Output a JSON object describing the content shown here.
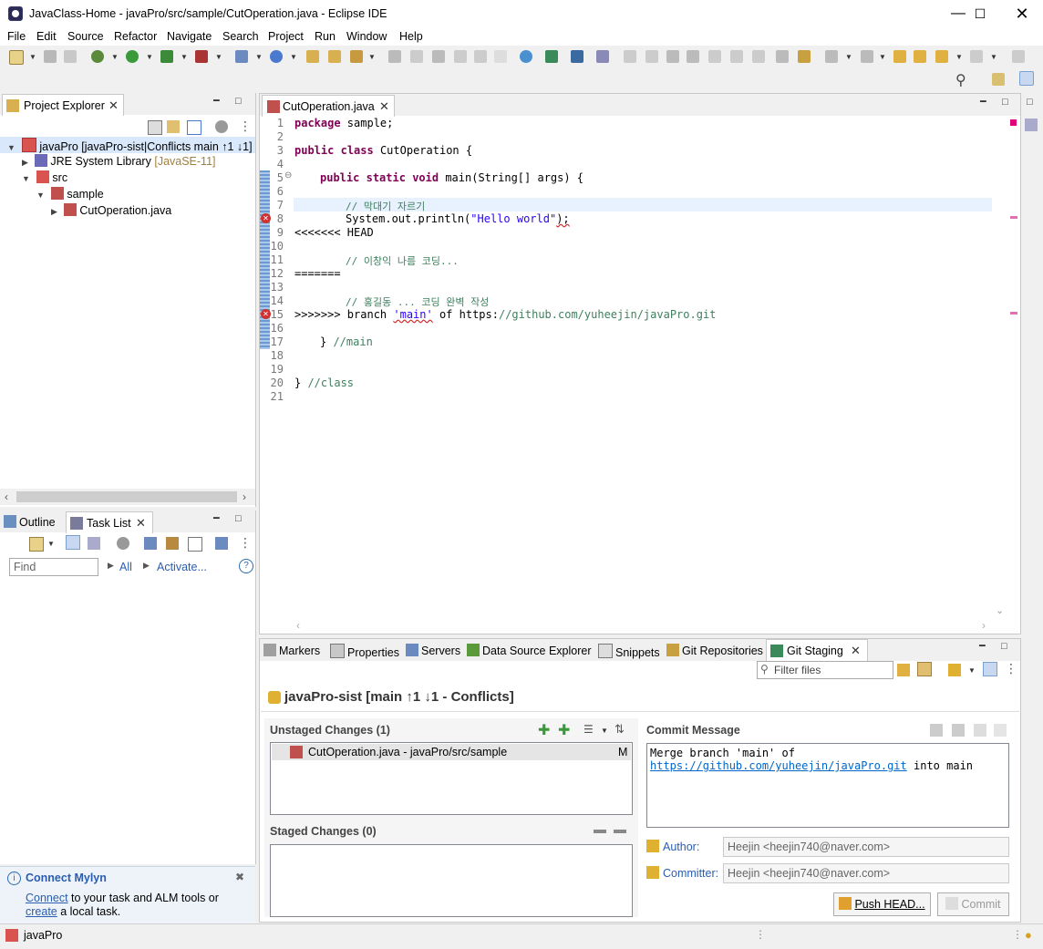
{
  "window": {
    "title": "JavaClass-Home - javaPro/src/sample/CutOperation.java - Eclipse IDE"
  },
  "menu": [
    "File",
    "Edit",
    "Source",
    "Refactor",
    "Navigate",
    "Search",
    "Project",
    "Run",
    "Window",
    "Help"
  ],
  "project_explorer": {
    "tab": "Project Explorer",
    "project": "javaPro [javaPro-sist|Conflicts main ↑1 ↓1]",
    "jre": "JRE System Library",
    "jre_version": "[JavaSE-11]",
    "src": "src",
    "package": "sample",
    "file": "CutOperation.java"
  },
  "outline": {
    "tab_outline": "Outline",
    "tab_tasklist": "Task List",
    "find_placeholder": "Find",
    "all": "All",
    "activate": "Activate..."
  },
  "mylyn": {
    "title": "Connect Mylyn",
    "connect": "Connect",
    "text1": " to your task and ALM tools or",
    "create": "create",
    "text2": " a local task."
  },
  "status": {
    "project": "javaPro"
  },
  "editor": {
    "tab": "CutOperation.java",
    "lines": [
      "1",
      "2",
      "3",
      "4",
      "5",
      "6",
      "7",
      "8",
      "9",
      "10",
      "11",
      "12",
      "13",
      "14",
      "15",
      "16",
      "17",
      "18",
      "19",
      "20",
      "21"
    ],
    "code": {
      "l1_kw": "package",
      "l1_rest": " sample;",
      "l3_kw1": "public",
      "l3_kw2": "class",
      "l3_rest": " CutOperation {",
      "l5_kw1": "public",
      "l5_kw2": "static",
      "l5_kw3": "void",
      "l5_rest": " main(String[] args) {",
      "l7": "// 막대기 자르기",
      "l8_a": "System.out.println(",
      "l8_str": "\"Hello world\"",
      "l8_b": ");",
      "l9": "<<<<<<< HEAD",
      "l11": "// 이창익 나름 코딩...",
      "l12": "=======",
      "l14": "// 홍길동 ... 코딩 완벽 작성",
      "l15_a": ">>>>>>> branch ",
      "l15_main": "'main'",
      "l15_b": " of https:",
      "l15_c": "//github.com/yuheejin/javaPro.git",
      "l17_a": "} ",
      "l17_c": "//main",
      "l20_a": "} ",
      "l20_c": "//class"
    }
  },
  "bottom_tabs": [
    "Markers",
    "Properties",
    "Servers",
    "Data Source Explorer",
    "Snippets",
    "Git Repositories",
    "Git Staging"
  ],
  "git_staging": {
    "filter_placeholder": "Filter files",
    "repo_title": "javaPro-sist [main ↑1 ↓1 - Conflicts]",
    "unstaged_label": "Unstaged Changes (1)",
    "unstaged_item": "CutOperation.java - javaPro/src/sample",
    "unstaged_status": "M",
    "staged_label": "Staged Changes (0)",
    "commit_label": "Commit Message",
    "commit_line1": "Merge branch 'main' of",
    "commit_link": "https://github.com/yuheejin/javaPro.git",
    "commit_line2_rest": " into main",
    "author_label": "Author:",
    "author_value": "Heejin <heejin740@naver.com>",
    "committer_label": "Committer:",
    "committer_value": "Heejin <heejin740@naver.com>",
    "push_button": "Push HEAD...",
    "commit_button": "Commit"
  }
}
